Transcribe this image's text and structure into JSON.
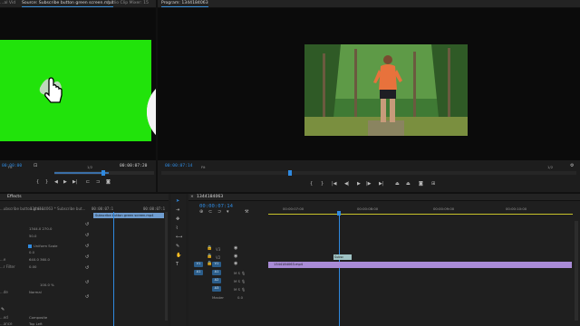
{
  "source_panel": {
    "tabs": [
      "...al Vid",
      "Source: Subscribe button green screen.mp4",
      "Audio Clip Mixer: 15"
    ],
    "timecode_start": "00:00:00",
    "fit_label": "Fit",
    "scale_label": "1/2",
    "timecode_end": "00:00:07:20"
  },
  "program_panel": {
    "title": "Program: 1344184063",
    "timecode": "00:00:07:14",
    "zoom": "Fit",
    "scale": "1/2"
  },
  "effects_panel": {
    "tab": "Effects",
    "source_label": "...ubscribe button gree...",
    "clip_label": "1344184063 * Subscribe but...",
    "clip_bar_label": "Subscribe button green screen.mp4",
    "timecode_a": "00:00:07:1",
    "timecode_b": "00:00:07:1",
    "rows": [
      {
        "label": "",
        "value": "1344.0   270.0"
      },
      {
        "label": "",
        "value": "50.0"
      },
      {
        "label": "",
        "value": "Uniform Scale"
      },
      {
        "label": "",
        "value": "0.0"
      },
      {
        "label": "...e",
        "value": "0.0"
      },
      {
        "label": "...r Filter",
        "value": "0.00"
      },
      {
        "label": "",
        "value": "100.0 %"
      },
      {
        "label": "...de",
        "value": "Normal"
      },
      {
        "label": "...ed",
        "value": "Composite"
      },
      {
        "label": "...ance",
        "value": "Top Left"
      }
    ],
    "anchor_values": "640.0   360.0"
  },
  "timeline": {
    "sequence_name": "1344184063",
    "timecode": "00:00:07:14",
    "ruler": [
      "00:00:07:00",
      "00:00:08:00",
      "00:00:09:00",
      "00:00:10:00"
    ],
    "tracks": [
      "V3",
      "V2",
      "V1",
      "A1",
      "A2",
      "A3"
    ],
    "clip_v2_label": "Subsc",
    "clip_v1_label": "1344184063.mp4",
    "master_label": "Master",
    "master_value": "0.0"
  }
}
